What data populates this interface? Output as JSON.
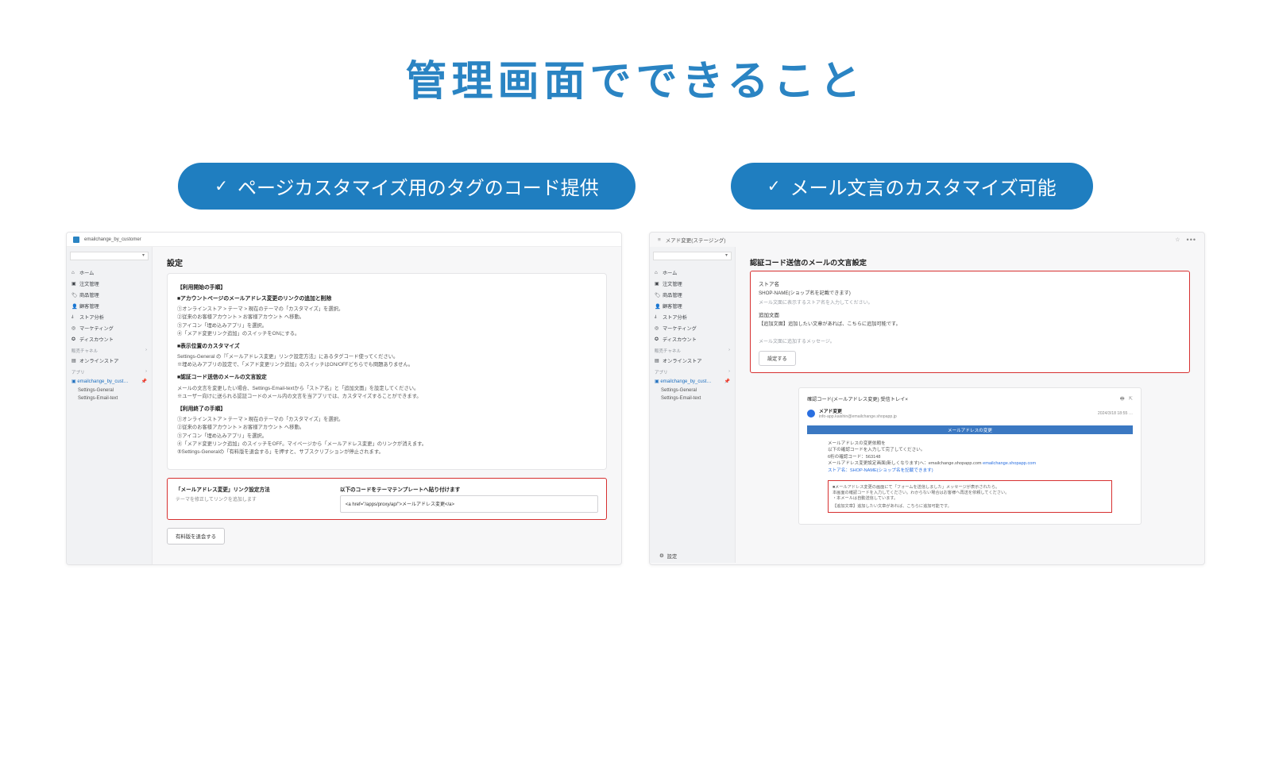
{
  "title": "管理画面でできること",
  "pills": {
    "left": "ページカスタマイズ用のタグのコード提供",
    "right": "メール文言のカスタマイズ可能"
  },
  "left": {
    "app_name": "emailchange_by_customer",
    "nav": {
      "home": "ホーム",
      "orders": "注文管理",
      "products": "商品管理",
      "customers": "顧客管理",
      "analytics": "ストア分析",
      "marketing": "マーケティング",
      "discounts": "ディスカウント",
      "sales_channels": "販売チャネル",
      "online_store": "オンラインストア",
      "apps": "アプリ",
      "app_short": "emailchange_by_cust…",
      "sub1": "Settings-General",
      "sub2": "Settings-Email-text"
    },
    "h1": "設定",
    "sec1_title": "【利用開始の手順】",
    "sec1_h": "■アカウントページのメールアドレス変更のリンクの追加と削除",
    "sec1_steps": [
      "①オンラインストア > テーマ > 現在のテーマの「カスタマイズ」を選択。",
      "②従来のお客様アカウント > お客様アカウント へ移動。",
      "③アイコン「埋め込みアプリ」を選択。",
      "④「メアド変更リンク追加」のスイッチをONにする。"
    ],
    "sec2_h": "■表示位置のカスタマイズ",
    "sec2_p": [
      "Settings-General の『「メールアドレス変更」リンク設定方法』にあるタグコード使ってください。",
      "※埋め込みアプリの設定で、「メアド変更リンク追加」のスイッチはON/OFFどちらでも問題ありません。"
    ],
    "sec3_h": "■認証コード送信のメールの文言設定",
    "sec3_p": [
      "メールの文言を変更したい場合、Settings-Email-textから「ストア名」と「追加文面」を設定してください。",
      "※ユーザー向けに送られる認証コードのメール内の文言を当アプリでは、カスタマイズすることができます。"
    ],
    "sec4_title": "【利用終了の手順】",
    "sec4_steps": [
      "①オンラインストア > テーマ > 現在のテーマの「カスタマイズ」を選択。",
      "②従来のお客様アカウント > お客様アカウント へ移動。",
      "③アイコン「埋め込みアプリ」を選択。",
      "④「メアド変更リンク追加」のスイッチをOFF。マイページから「メールアドレス変更」のリンクが消えます。",
      "⑤Settings-Generalの「有料版を退会する」を押すと、サブスクリプションが停止されます。"
    ],
    "redbox": {
      "left_label": "「メールアドレス変更」リンク設定方法",
      "left_sub": "テーマを修正してリンクを追加します",
      "right_label": "以下のコードをテーマテンプレートへ貼り付けます",
      "code": "<a href=\"/apps/proxy/ap/\">メールアドレス変更</a>"
    },
    "cancel_btn": "有料版を退会する"
  },
  "right": {
    "crumb": "メアド変更(ステージング)",
    "nav": {
      "home": "ホーム",
      "orders": "注文管理",
      "products": "商品管理",
      "customers": "顧客管理",
      "analytics": "ストア分析",
      "marketing": "マーケティング",
      "discounts": "ディスカウント",
      "sales_channels": "販売チャネル",
      "online_store": "オンラインストア",
      "apps": "アプリ",
      "app_short": "emailchange_by_cust…",
      "sub1": "Settings-General",
      "sub2": "Settings-Email-text",
      "settings": "設定"
    },
    "h1": "認証コード送信のメールの文言設定",
    "form": {
      "store_label": "ストア名",
      "store_value": "SHOP-NAME(ショップ名を記載できます)",
      "store_hint": "メール文面に表示するストア名を入力してください。",
      "extra_label": "追加文面",
      "extra_value": "【追加文面】追加したい文章があれば、こちらに追加可能です。",
      "extra_hint": "メール文面に追加するメッセージ。",
      "submit": "設定する"
    },
    "mail": {
      "subject": "確認コード(メールアドレス変更) 受信トレイ×",
      "from_name": "メアド変更",
      "from_addr": "info-app.kaishin@emailchange.shopapp.jp",
      "date": "2024/3/18 18:55   …",
      "bar": "メールアドレスの変更",
      "body": [
        "メールアドレスの変更依頼を",
        "以下の確認コードを入力して完了してください。",
        "6桁の確認コード：563148",
        "メールアドレス変更設定画面(新しくなります)へ：emailchange.shopapp.com"
      ],
      "store_line": "ストア名：SHOP-NAME(ショップ名を記載できます)",
      "note": [
        "■メールアドレス変更の画面にて「フォームを送信しました」メッセージが表示されたら。",
        "本画面の確認コードを入力してください。わからない場合はお客様へ再送を依頼してください。",
        "・本メールは自動送信しています。"
      ],
      "note2": "【追加文章】追加したい文章があれば、こちらに追加可能です。"
    }
  }
}
